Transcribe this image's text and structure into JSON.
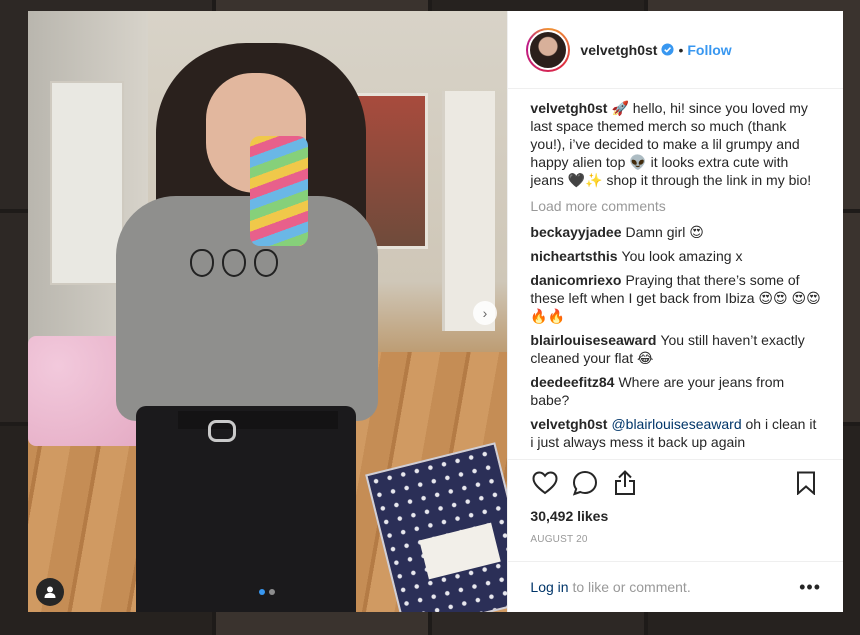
{
  "post": {
    "username": "velvetgh0st",
    "separator": "•",
    "follow_label": "Follow",
    "caption_text": "🚀 hello, hi! since you loved my last space themed merch so much (thank you!), i’ve decided to make a lil grumpy and happy alien top 👽 it looks extra cute with jeans 🖤✨ shop it through the link in my bio!",
    "load_more_label": "Load more comments",
    "comments": [
      {
        "user": "beckayyjadee",
        "text": "Damn girl 😍"
      },
      {
        "user": "nicheartsthis",
        "text": "You look amazing x"
      },
      {
        "user": "danicomriexo",
        "text": "Praying that there’s some of these left when I get back from Ibiza 😍😍 😍😍🔥🔥"
      },
      {
        "user": "blairlouiseseaward",
        "text": "You still haven’t exactly cleaned your flat 😂"
      },
      {
        "user": "deedeefitz84",
        "text": "Where are your jeans from babe?"
      }
    ],
    "reply": {
      "user": "velvetgh0st",
      "mention": "@blairlouiseseaward",
      "text": "oh i clean it i just always mess it back up again"
    },
    "likes_label": "30,492 likes",
    "date_label": "AUGUST 20",
    "login_link": "Log in",
    "login_suffix": " to like or comment.",
    "more_label": "•••",
    "carousel_next_label": "›"
  },
  "colors": {
    "accent": "#3897f0",
    "verified": "#3897f0",
    "link": "#003569",
    "muted": "#999999"
  },
  "icons": [
    "heart-icon",
    "comment-icon",
    "share-icon",
    "bookmark-icon",
    "verified-icon",
    "user-tag-icon",
    "chevron-right-icon",
    "more-icon"
  ]
}
